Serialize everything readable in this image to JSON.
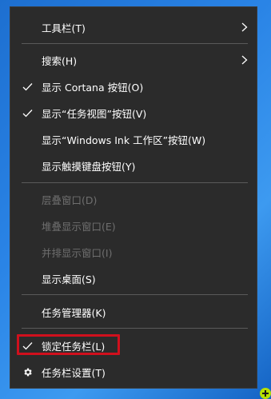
{
  "menu": {
    "toolbar": "工具栏(T)",
    "search": "搜索(H)",
    "show_cortana": "显示 Cortana 按钮(O)",
    "show_task_view": "显示“任务视图”按钮(V)",
    "show_ink": "显示“Windows Ink 工作区”按钮(W)",
    "show_touch_keyboard": "显示触摸键盘按钮(Y)",
    "cascade": "层叠窗口(D)",
    "stacked": "堆叠显示窗口(E)",
    "side_by_side": "并排显示窗口(I)",
    "show_desktop": "显示桌面(S)",
    "task_manager": "任务管理器(K)",
    "lock_taskbar": "锁定任务栏(L)",
    "taskbar_settings": "任务栏设置(T)"
  },
  "icons": {
    "check": "check-icon",
    "submenu": "chevron-right-icon",
    "settings": "gear-icon"
  },
  "colors": {
    "menu_bg": "#2b2b2b",
    "text": "#ffffff",
    "disabled_text": "#6f6f6f",
    "highlight_border": "#d0101d",
    "tray_badge": "#b8e000"
  }
}
